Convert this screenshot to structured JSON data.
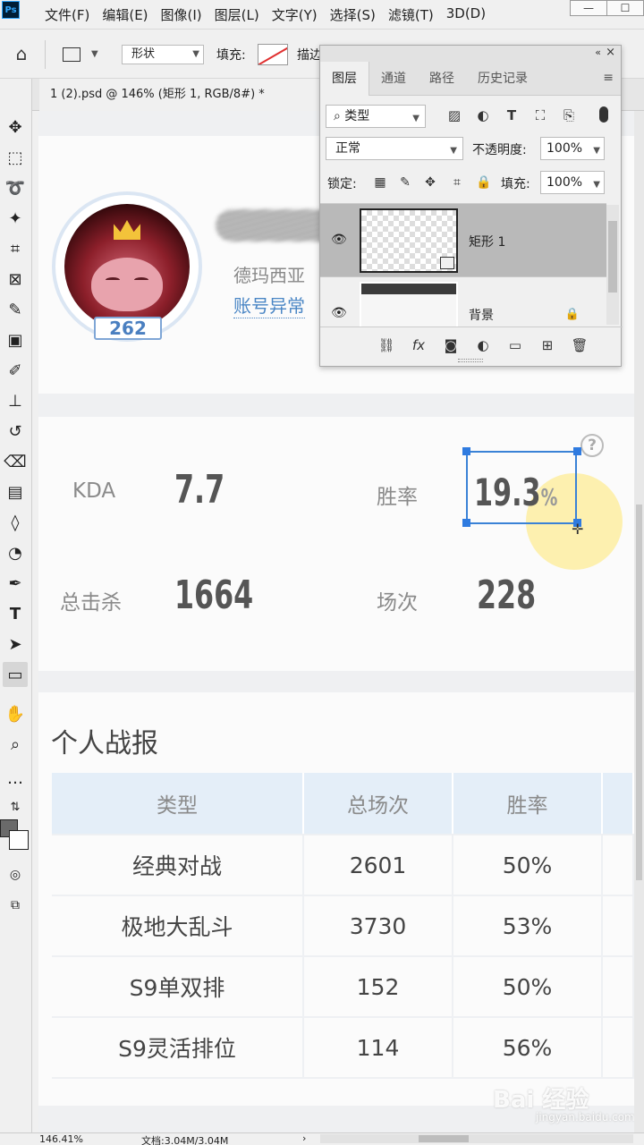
{
  "app": {
    "logo": "Ps"
  },
  "menu": [
    "文件(F)",
    "编辑(E)",
    "图像(I)",
    "图层(L)",
    "文字(Y)",
    "选择(S)",
    "滤镜(T)",
    "3D(D)"
  ],
  "window_buttons": [
    "—",
    "☐"
  ],
  "options": {
    "mode": "形状",
    "fill_label": "填充:",
    "stroke_label": "描边"
  },
  "document": {
    "tab_title": "1 (2).psd @ 146% (矩形 1, RGB/8#) *",
    "close": "×"
  },
  "profile": {
    "level": "262",
    "server": "德玛西亚",
    "account_status": "账号异常"
  },
  "stats": {
    "kda_label": "KDA",
    "kda_value": "7.7",
    "winrate_label": "胜率",
    "winrate_value": "19.3",
    "winrate_unit": "%",
    "kills_label": "总击杀",
    "kills_value": "1664",
    "games_label": "场次",
    "games_value": "228"
  },
  "report": {
    "title": "个人战报",
    "headers": [
      "类型",
      "总场次",
      "胜率"
    ],
    "rows": [
      [
        "经典对战",
        "2601",
        "50%"
      ],
      [
        "极地大乱斗",
        "3730",
        "53%"
      ],
      [
        "S9单双排",
        "152",
        "50%"
      ],
      [
        "S9灵活排位",
        "114",
        "56%"
      ]
    ]
  },
  "watermark": {
    "main": "Bai 经验",
    "sub": "jingyan.baidu.com"
  },
  "status": {
    "zoom": "146.41%",
    "doc": "文档:3.04M/3.04M",
    "arrow": "›"
  },
  "layers_panel": {
    "tabs": [
      "图层",
      "通道",
      "路径",
      "历史记录"
    ],
    "filter": "类型",
    "blend_mode": "正常",
    "opacity_label": "不透明度:",
    "opacity": "100%",
    "lock_label": "锁定:",
    "fill_label": "填充:",
    "fill": "100%",
    "layers": [
      {
        "name": "矩形 1",
        "selected": true
      },
      {
        "name": "背景",
        "locked": true
      }
    ]
  },
  "colors": {
    "accent": "#3a82d6",
    "link": "#4a86c5",
    "table_header": "#e4eef8",
    "foreground": "#6a6a6a",
    "background": "#ffffff"
  }
}
